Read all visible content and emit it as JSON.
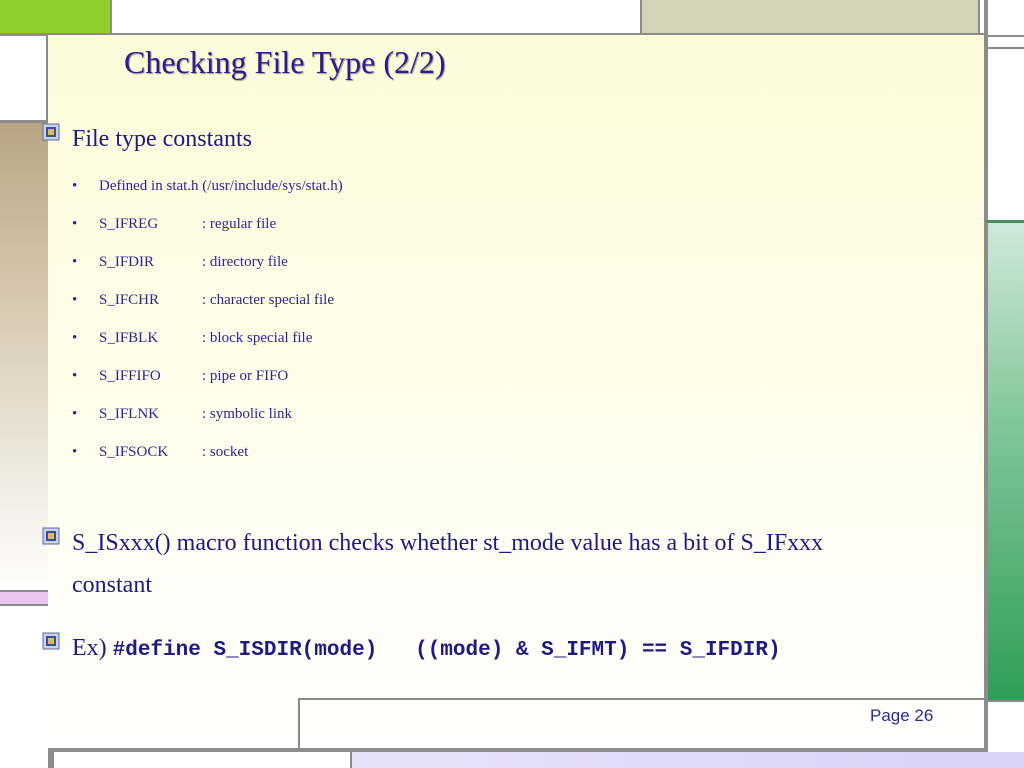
{
  "slide": {
    "title": "Checking File Type (2/2)",
    "page": "Page 26",
    "colors": {
      "title": "#2e1a8a",
      "text": "#1f1a80",
      "green_bar": "#2f9e57",
      "lime_block": "#8fcf2a",
      "pink_band": "#e8c6f0"
    }
  },
  "bullets": [
    {
      "icon": "bullet-square-icon",
      "text": "File type constants"
    },
    {
      "icon": "bullet-square-icon",
      "text_line1": "S_ISxxx()  macro function checks whether st_mode  value has a bit of S_IFxxx",
      "text_line2": "constant"
    },
    {
      "icon": "bullet-square-icon",
      "prefix": "Ex) ",
      "code": "#define S_ISDIR(mode)   ((mode) & S_IFMT) == S_IFDIR)"
    }
  ],
  "sub_items": [
    {
      "marker": "•",
      "name": "Defined in stat.h (/usr/include/sys/stat.h)",
      "desc": ""
    },
    {
      "marker": "•",
      "name": "S_IFREG",
      "desc": ": regular file"
    },
    {
      "marker": "•",
      "name": "S_IFDIR",
      "desc": ": directory file"
    },
    {
      "marker": "•",
      "name": "S_IFCHR",
      "desc": ": character special file"
    },
    {
      "marker": "•",
      "name": "S_IFBLK",
      "desc": ": block special file"
    },
    {
      "marker": "•",
      "name": "S_IFFIFO",
      "desc": ": pipe or FIFO"
    },
    {
      "marker": "•",
      "name": "S_IFLNK",
      "desc": ": symbolic link"
    },
    {
      "marker": "•",
      "name": "S_IFSOCK",
      "desc": ": socket"
    }
  ]
}
